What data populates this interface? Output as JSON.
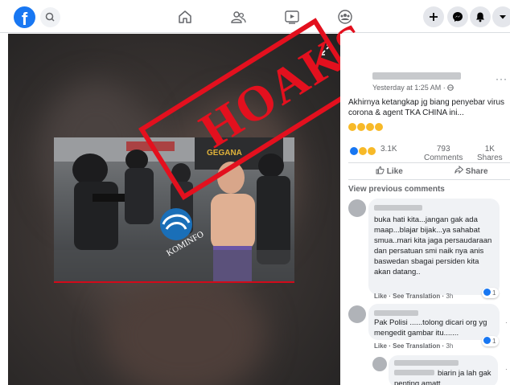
{
  "topbar": {
    "logo": "f",
    "icons": [
      "facebook-logo-icon",
      "search-icon",
      "home-icon",
      "friends-icon",
      "watch-icon",
      "groups-icon",
      "plus-icon",
      "messenger-icon",
      "bell-icon",
      "dropdown-icon"
    ]
  },
  "image": {
    "stamp_text": "HOAKS",
    "logo_text": "KOMINFO",
    "vehicle_text": "GEGANA"
  },
  "post": {
    "timestamp": "Yesterday at 1:25 AM · ",
    "more": "···",
    "text": "Akhirnya ketangkap jg biang penyebar virus corona & agent TKA CHINA ini...",
    "reaction_count": "3.1K",
    "comments_count": "793",
    "comments_label": "Comments",
    "shares_count": "1K",
    "shares_label": "Shares",
    "like_label": "Like",
    "share_label": "Share",
    "view_previous": "View previous comments"
  },
  "comments": [
    {
      "text": "buka hati kita...jangan gak ada maap...blajar bijak...ya sahabat smua..mari kita jaga persaudaraan dan persatuan smi naik nya anis baswedan sbagai persiden kita akan datang..",
      "like": "Like",
      "see_translation": "See Translation",
      "time": "3h",
      "reactions": "1"
    },
    {
      "text": "Pak Polisi ......tolong dicari org yg mengedit gambar itu.......",
      "like": "Like",
      "see_translation": "See Translation",
      "time": "3h",
      "reactions": "1"
    },
    {
      "text": "biarin ja lah gak penting amatt",
      "like": "",
      "see_translation": "",
      "time": "",
      "reactions": ""
    }
  ],
  "colors": {
    "brand": "#1877f2",
    "stamp_red": "#e3101e",
    "text": "#1c1e21",
    "muted": "#65676b",
    "bubble": "#f0f2f5"
  }
}
